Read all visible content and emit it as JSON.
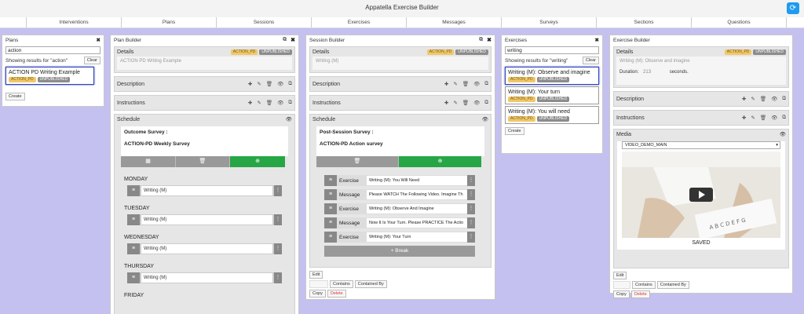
{
  "app": {
    "title": "Appatella Exercise Builder"
  },
  "nav": {
    "tabs": [
      "",
      "Interventions",
      "Plans",
      "Sessions",
      "Exercises",
      "Messages",
      "Surveys",
      "Sections",
      "Questions"
    ]
  },
  "plans": {
    "title": "Plans",
    "search": "action",
    "showing": "Showing results for \"action\"",
    "clear": "Clear",
    "items": [
      {
        "title": "ACTION PD Writing Example",
        "badge1": "ACTION_PD",
        "badge2": "UNPUBLISHED"
      }
    ],
    "create": "Create"
  },
  "plan_builder": {
    "title": "Plan Builder",
    "details": "Details",
    "badge1": "ACTION_PD",
    "badge2": "UNPUBLISHED",
    "name": "ACTION PD Writing Example",
    "description": "Description",
    "instructions": "Instructions",
    "schedule": "Schedule",
    "outcome_label": "Outcome Survey :",
    "outcome_name": "ACTION-PD Weekly Survey",
    "days": [
      {
        "name": "MONDAY",
        "item": "Writing (M)"
      },
      {
        "name": "TUESDAY",
        "item": "Writing (M)"
      },
      {
        "name": "WEDNESDAY",
        "item": "Writing (M)"
      },
      {
        "name": "THURSDAY",
        "item": "Writing (M)"
      },
      {
        "name": "FRIDAY",
        "item": ""
      }
    ]
  },
  "session_builder": {
    "title": "Session Builder",
    "details": "Details",
    "badge1": "ACTION_PD",
    "badge2": "UNPUBLISHED",
    "name": "Writing (M)",
    "description": "Description",
    "instructions": "Instructions",
    "schedule": "Schedule",
    "post_label": "Post-Session Survey :",
    "post_name": "ACTION-PD Action survey",
    "items": [
      {
        "type": "Exercise",
        "value": "Writing (M): You Will Need"
      },
      {
        "type": "Message",
        "value": "Please WATCH The Following Video. Imagine Th"
      },
      {
        "type": "Exercise",
        "value": "Writing (M): Observe And Imagine"
      },
      {
        "type": "Message",
        "value": "Now It Is Your Turn. Please PRACTICE The Actio"
      },
      {
        "type": "Exercise",
        "value": "Writing (M): Your Turn"
      }
    ],
    "break": "+ Break",
    "edit": "Edit",
    "contains": "Contains",
    "contained_by": "Contained By",
    "copy": "Copy",
    "delete": "Delete"
  },
  "exercises": {
    "title": "Exercises",
    "search": "writing",
    "showing": "Showing results for \"writing\"",
    "clear": "Clear",
    "items": [
      {
        "title": "Writing (M): Observe and imagine",
        "badge1": "ACTION_PD",
        "badge2": "UNPUBLISHED"
      },
      {
        "title": "Writing (M): Your turn",
        "badge1": "ACTION_PD",
        "badge2": "UNPUBLISHED"
      },
      {
        "title": "Writing (M): You will need",
        "badge1": "ACTION_PD",
        "badge2": "UNPUBLISHED"
      }
    ],
    "create": "Create"
  },
  "exercise_builder": {
    "title": "Exercise Builder",
    "details": "Details",
    "badge1": "ACTION_PD",
    "badge2": "UNPUBLISHED",
    "name": "Writing (M): Observe and imagine",
    "duration_label": "Duration:",
    "duration_value": "213",
    "duration_unit": "seconds.",
    "description": "Description",
    "instructions": "Instructions",
    "media": "Media",
    "media_select": "VIDEO_DEMO_MAIN",
    "saved": "SAVED",
    "edit": "Edit",
    "contains": "Contains",
    "contained_by": "Contained By",
    "copy": "Copy",
    "delete": "Delete"
  }
}
